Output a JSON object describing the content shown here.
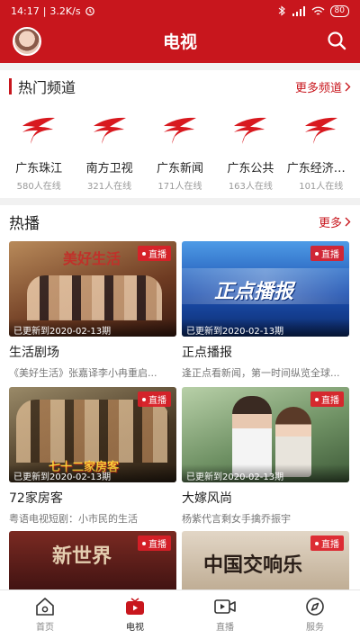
{
  "status": {
    "time": "14:17",
    "speed": "3.2K/s",
    "battery": "80"
  },
  "header": {
    "title": "电视"
  },
  "hot_channels": {
    "title": "热门频道",
    "more": "更多频道",
    "items": [
      {
        "name": "广东珠江",
        "online": "580人在线"
      },
      {
        "name": "南方卫视",
        "online": "321人在线"
      },
      {
        "name": "广东新闻",
        "online": "171人在线"
      },
      {
        "name": "广东公共",
        "online": "163人在线"
      },
      {
        "name": "广东经济科...",
        "online": "101人在线"
      }
    ]
  },
  "hot_play": {
    "title": "热播",
    "more": "更多",
    "live_label": "直播",
    "cards": [
      {
        "title": "生活剧场",
        "desc": "《美好生活》张嘉译李小冉重启...",
        "updated": "已更新到2020-02-13期",
        "thumb_color": "#8a4b2e",
        "thumb_title": "美好生活"
      },
      {
        "title": "正点播报",
        "desc": "逢正点看新闻，第一时间纵览全球...",
        "updated": "已更新到2020-02-13期",
        "thumb_color": "#1c4ea8",
        "thumb_title": "正点播报"
      },
      {
        "title": "72家房客",
        "desc": "粤语电视短剧：小市民的生活",
        "updated": "已更新到2020-02-13期",
        "thumb_color": "#6b5a3a",
        "thumb_title": "七十二家房客"
      },
      {
        "title": "大嫁风尚",
        "desc": "杨紫代言剩女手擒乔振宇",
        "updated": "已更新到2020-02-13期",
        "thumb_color": "#7d9e72",
        "thumb_title": ""
      },
      {
        "title": "",
        "desc": "",
        "updated": "",
        "thumb_color": "#5a1e1a",
        "thumb_title": "新世界"
      },
      {
        "title": "",
        "desc": "",
        "updated": "",
        "thumb_color": "#c9b8a4",
        "thumb_title": "中国交响乐"
      }
    ]
  },
  "bottom_nav": [
    {
      "label": "首页",
      "icon": "home-icon"
    },
    {
      "label": "电视",
      "icon": "tv-icon"
    },
    {
      "label": "直播",
      "icon": "live-video-icon"
    },
    {
      "label": "服务",
      "icon": "compass-icon"
    }
  ],
  "colors": {
    "brand": "#c8161d",
    "bg_divider": "#f1f1f1"
  }
}
